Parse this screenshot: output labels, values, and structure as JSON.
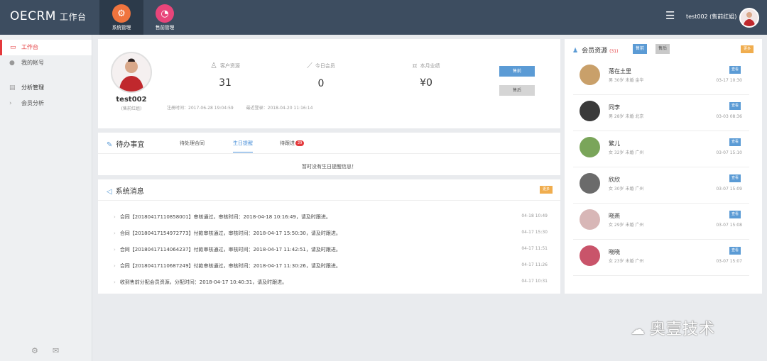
{
  "app": {
    "brand": "OECRM",
    "subtitle": "工作台"
  },
  "nav": [
    {
      "label": "系统管理",
      "icon": "gear-icon",
      "color": "#f0743e"
    },
    {
      "label": "售前管理",
      "icon": "pie-icon",
      "color": "#e8457a"
    }
  ],
  "user": {
    "display": "test002 (售前红姐)"
  },
  "sidebar": {
    "items": [
      {
        "label": "工作台",
        "icon": "desktop-icon"
      },
      {
        "label": "我的帐号",
        "icon": "user-icon"
      },
      {
        "label": "分析管理",
        "icon": "chart-icon"
      },
      {
        "label": "会员分析",
        "icon": "chevron-right-icon"
      }
    ]
  },
  "profile": {
    "name": "test002",
    "role": "(售前红姐)",
    "stats": [
      {
        "label": "客户资源",
        "value": "31"
      },
      {
        "label": "今日会员",
        "value": "0"
      },
      {
        "label": "本月业绩",
        "value": "¥0"
      }
    ],
    "register_label": "注册时间：2017-06-28 19:04:59",
    "lastlogin_label": "最近登录：2018-04-20 11:16:14",
    "btn_presale": "售前",
    "btn_aftersale": "售后"
  },
  "todo": {
    "title": "待办事宜",
    "tabs": [
      "待处理合同",
      "生日提醒",
      "待跟进"
    ],
    "followup_badge": "29",
    "empty": "暂时没有生日提醒信息！"
  },
  "sysmsg": {
    "title": "系统消息",
    "more": "更多",
    "items": [
      {
        "text": "合同【20180417110858001】审核通过，审核时间：2018-04-18 10:16:49，请及时跟进。",
        "time": "04-18 10:49"
      },
      {
        "text": "合同【20180417154972773】付款审核通过，审核时间：2018-04-17 15:50:30，请及时跟进。",
        "time": "04-17 15:30"
      },
      {
        "text": "合同【20180417114064237】付款审核通过，审核时间：2018-04-17 11:42:51，请及时跟进。",
        "time": "04-17 11:51"
      },
      {
        "text": "合同【20180417110687249】付款审核通过，审核时间：2018-04-17 11:30:26，请及时跟进。",
        "time": "04-17 11:26"
      },
      {
        "text": "收到售前分配会员资源，分配时间：2018-04-17 10:40:31，请及时跟进。",
        "time": "04-17 10:31"
      }
    ]
  },
  "members": {
    "title": "会员资源",
    "count": "(31)",
    "btn_presale": "售前",
    "btn_aftersale": "售后",
    "more": "更多",
    "view_label": "查看",
    "list": [
      {
        "name": "落在土里",
        "info": "男 30岁 未婚 金华",
        "time": "03-17 10:30",
        "bg": "#c9a06a"
      },
      {
        "name": "同李",
        "info": "男 28岁 未婚 北京",
        "time": "03-03 08:36",
        "bg": "#3a3a3a"
      },
      {
        "name": "繁儿",
        "info": "女 32岁 未婚 广州",
        "time": "03-07 15:10",
        "bg": "#7aa55a"
      },
      {
        "name": "欣欣",
        "info": "女 30岁 未婚 广州",
        "time": "03-07 15:09",
        "bg": "#6b6b6b"
      },
      {
        "name": "晓燕",
        "info": "女 29岁 未婚 广州",
        "time": "03-07 15:08",
        "bg": "#d8b7b7"
      },
      {
        "name": "晓晓",
        "info": "女 23岁 未婚 广州",
        "time": "03-07 15:07",
        "bg": "#c9546a"
      }
    ]
  },
  "watermark": "奥壹技术"
}
